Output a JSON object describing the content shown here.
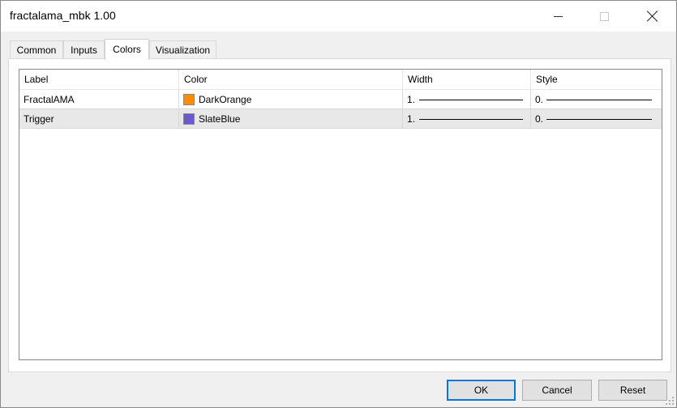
{
  "window": {
    "title": "fractalama_mbk 1.00"
  },
  "tabs": [
    {
      "label": "Common"
    },
    {
      "label": "Inputs"
    },
    {
      "label": "Colors"
    },
    {
      "label": "Visualization"
    }
  ],
  "active_tab": "Colors",
  "table": {
    "headers": {
      "label": "Label",
      "color": "Color",
      "width": "Width",
      "style": "Style"
    },
    "rows": [
      {
        "label": "FractalAMA",
        "color_name": "DarkOrange",
        "color_hex": "#ff8c00",
        "width": "1.",
        "style": "0."
      },
      {
        "label": "Trigger",
        "color_name": "SlateBlue",
        "color_hex": "#6a5acd",
        "width": "1.",
        "style": "0."
      }
    ]
  },
  "buttons": {
    "ok": "OK",
    "cancel": "Cancel",
    "reset": "Reset"
  }
}
